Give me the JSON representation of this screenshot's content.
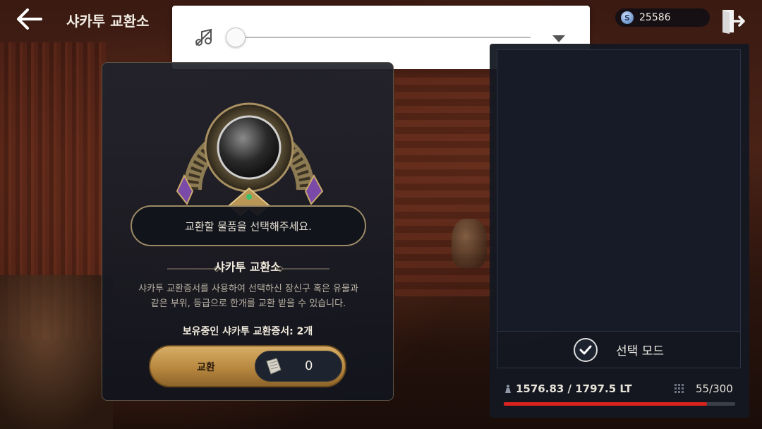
{
  "header": {
    "title": "샤카투 교환소",
    "back_icon": "arrow-left-icon",
    "exit_icon": "exit-door-icon",
    "currency": {
      "icon": "silver-coin-icon",
      "coin_symbol": "S",
      "value": "25586"
    }
  },
  "volume_popup": {
    "music_icon": "music-off-icon",
    "level": 0,
    "expand_icon": "chevron-down-icon"
  },
  "exchange_panel": {
    "prompt": "교환할 물품을 선택해주세요.",
    "heading": "샤카투 교환소",
    "description_line1": "샤카투 교환증서를 사용하여 선택하신 장신구 혹은 유물과",
    "description_line2": "같은 부위, 등급으로 한개를 교환 받을 수 있습니다.",
    "certificate_count": "보유중인 샤카투 교환증서: 2개",
    "exchange_button": {
      "label": "교환",
      "quantity": "0",
      "icon": "scroll-icon"
    }
  },
  "inventory_panel": {
    "select_mode_label": "선택 모드",
    "weight": {
      "text": "1576.83 / 1797.5 LT",
      "current": 1576.83,
      "max": 1797.5
    },
    "slots": "55/300"
  },
  "colors": {
    "accent_gold": "#c49a52",
    "weight_bar": "#d9231f",
    "panel_dark": "#14182a"
  }
}
